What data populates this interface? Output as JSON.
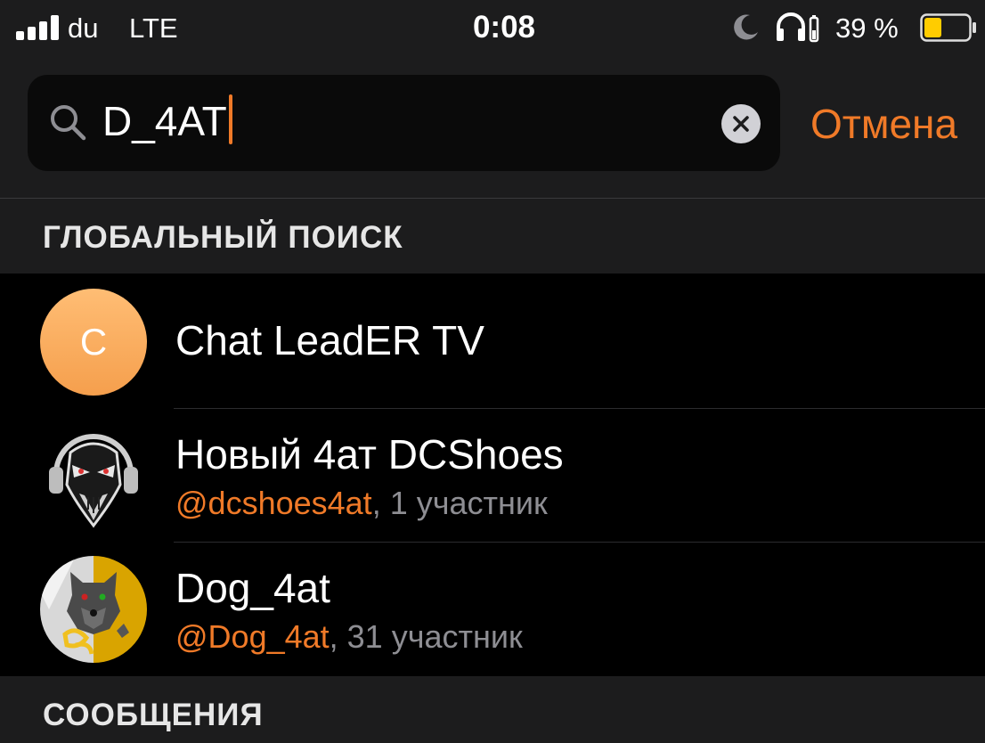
{
  "status_bar": {
    "carrier": "du",
    "network": "LTE",
    "time": "0:08",
    "battery_percent": "39 %",
    "battery_level": 0.39,
    "icons": [
      "signal-icon",
      "moon-icon",
      "headphones-icon",
      "battery-icon"
    ]
  },
  "search": {
    "query": "D_4AT",
    "cancel_label": "Отмена"
  },
  "sections": {
    "global": "ГЛОБАЛЬНЫЙ ПОИСК",
    "messages": "СООБЩЕНИЯ"
  },
  "results": [
    {
      "avatar_letter": "C",
      "title": "Chat LeadER TV"
    },
    {
      "title": "Новый 4ат DCShoes",
      "handle": "@dcshoes4at",
      "members": ", 1 участник"
    },
    {
      "title": "Dog_4at",
      "handle": "@Dog_4at",
      "members": ", 31 участник"
    }
  ],
  "colors": {
    "accent": "#f07a28",
    "background": "#000000",
    "bar_background": "#1c1c1d",
    "secondary_text": "#8e8e93",
    "battery_fill": "#ffcc00"
  }
}
